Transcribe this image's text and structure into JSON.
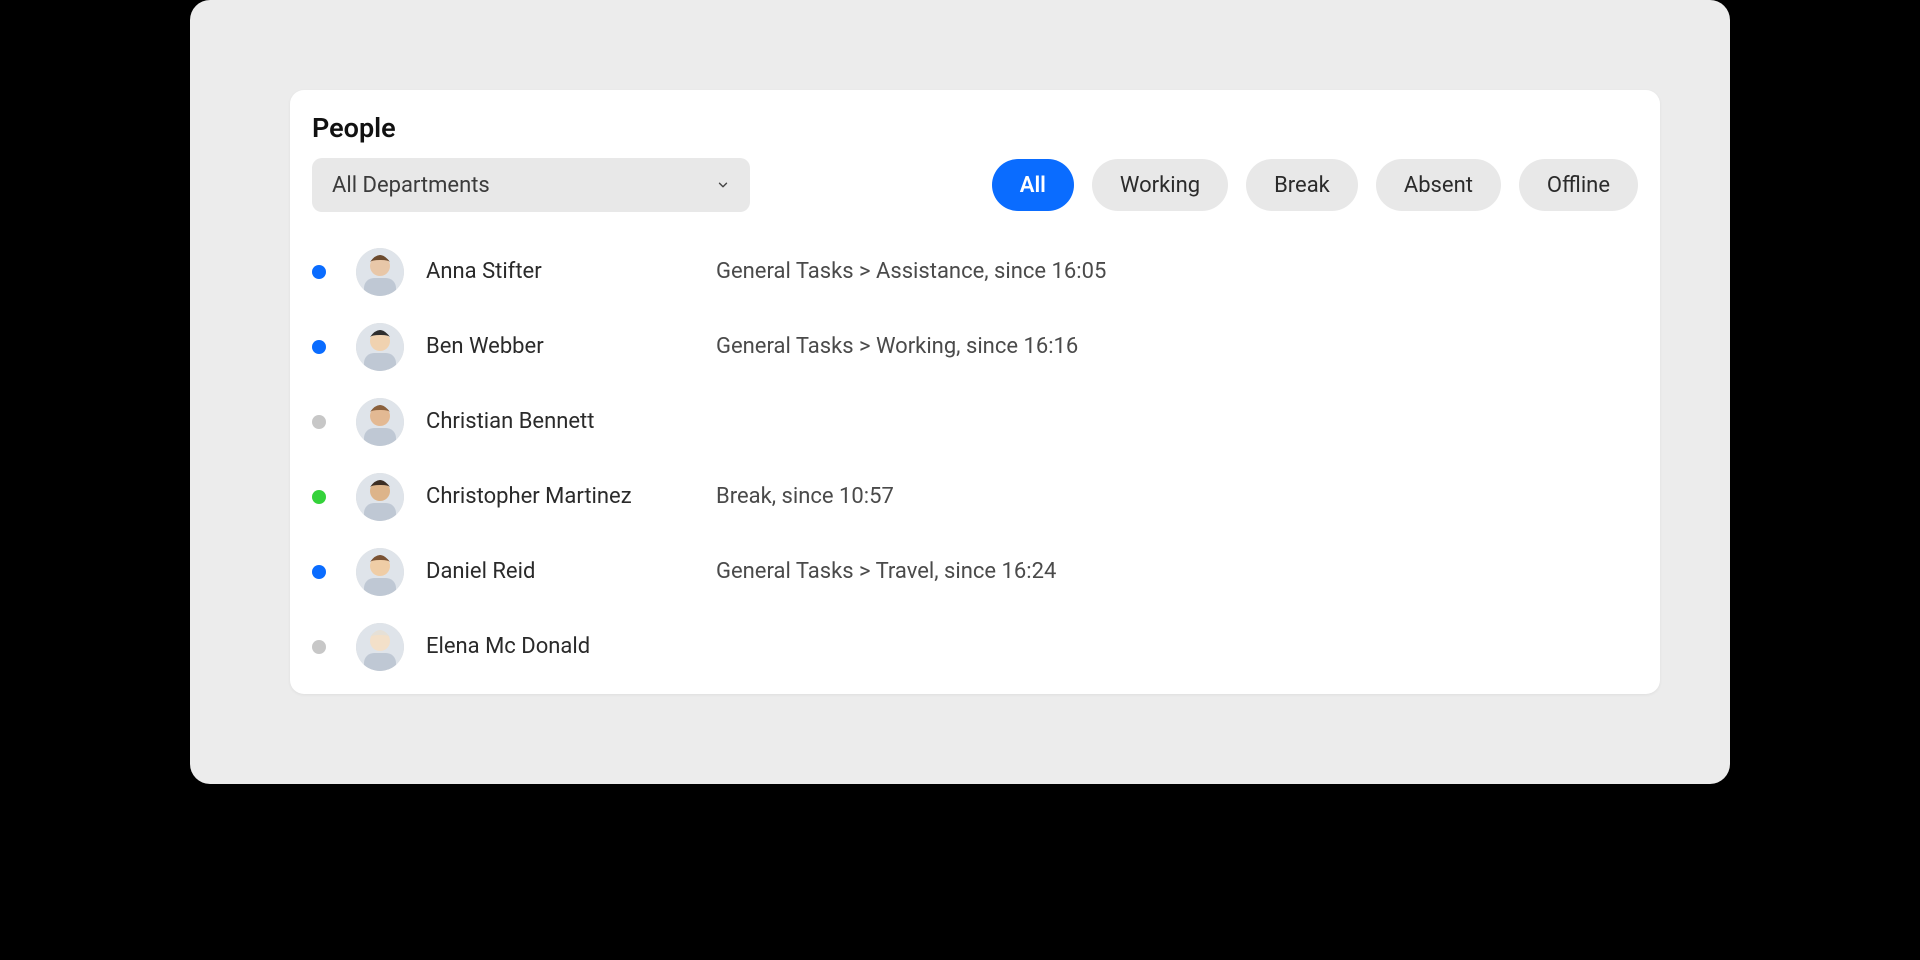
{
  "title": "People",
  "department_selector": {
    "label": "All Departments"
  },
  "filters": [
    {
      "key": "all",
      "label": "All",
      "active": true
    },
    {
      "key": "working",
      "label": "Working",
      "active": false
    },
    {
      "key": "break",
      "label": "Break",
      "active": false
    },
    {
      "key": "absent",
      "label": "Absent",
      "active": false
    },
    {
      "key": "offline",
      "label": "Offline",
      "active": false
    }
  ],
  "status_colors": {
    "working": "#0a6cff",
    "break": "#34d23a",
    "offline": "#c7c7c7"
  },
  "people": [
    {
      "name": "Anna Stifter",
      "dot": "blue",
      "status": "General Tasks > Assistance, since 16:05"
    },
    {
      "name": "Ben Webber",
      "dot": "blue",
      "status": "General Tasks > Working, since 16:16"
    },
    {
      "name": "Christian Bennett",
      "dot": "grey",
      "status": ""
    },
    {
      "name": "Christopher Martinez",
      "dot": "green",
      "status": "Break, since 10:57"
    },
    {
      "name": "Daniel Reid",
      "dot": "blue",
      "status": "General Tasks > Travel, since 16:24"
    },
    {
      "name": "Elena Mc Donald",
      "dot": "grey",
      "status": ""
    }
  ]
}
